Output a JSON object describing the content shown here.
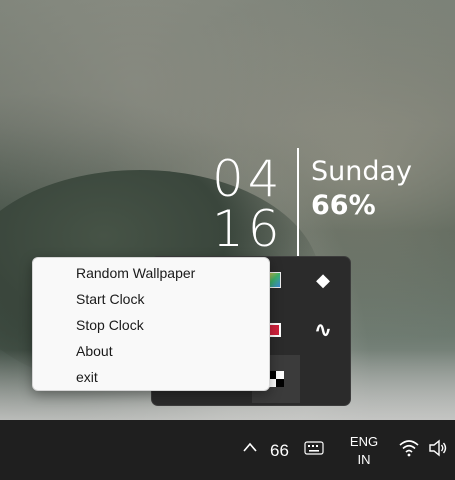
{
  "clock": {
    "hour": "04",
    "minute": "16",
    "day": "Sunday",
    "battery": "66%"
  },
  "context_menu": {
    "items": [
      {
        "label": "Random Wallpaper"
      },
      {
        "label": "Start Clock"
      },
      {
        "label": "Stop Clock"
      },
      {
        "label": "About"
      },
      {
        "label": "exit"
      }
    ]
  },
  "tray_flyout": {
    "icons": [
      "colorful-app-icon",
      "diamond-app-icon",
      "red-app-icon",
      "wave-app-icon",
      "checker-app-icon"
    ]
  },
  "taskbar": {
    "tray_count": "66",
    "lang_line1": "ENG",
    "lang_line2": "IN",
    "icons": [
      "chevron-up-icon",
      "keyboard-icon",
      "wifi-icon",
      "volume-icon"
    ]
  }
}
